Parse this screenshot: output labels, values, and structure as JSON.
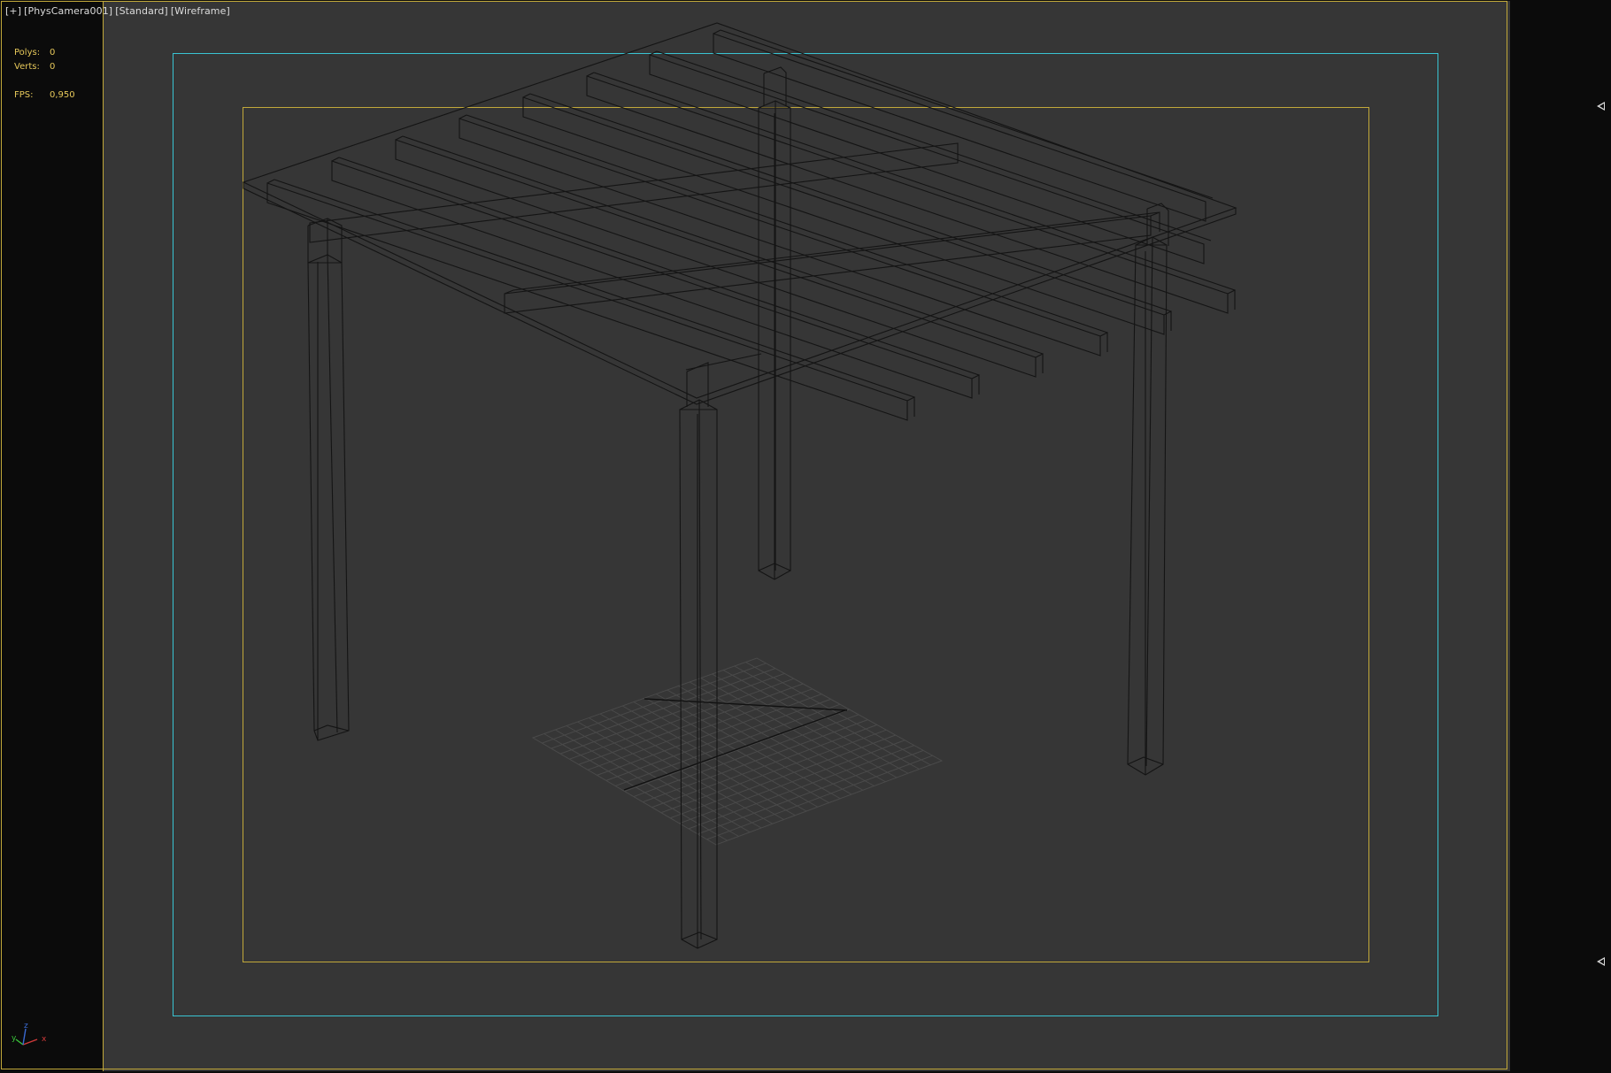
{
  "viewport": {
    "label_items": [
      "[+]",
      "[PhysCamera001]",
      "[Standard]",
      "[Wireframe]"
    ],
    "stats": {
      "polys_label": "Polys:",
      "polys_value": "0",
      "verts_label": "Verts:",
      "verts_value": "0",
      "fps_label": "FPS:",
      "fps_value": "0,950"
    },
    "colors": {
      "background": "#363636",
      "frame_border": "#c2a93a",
      "safe_frame": "#39c4d2",
      "wireframe": "#141414",
      "grid": "#8a8a8a",
      "stats_text": "#e6c85a"
    },
    "axis_gizmo": {
      "x": "x",
      "y": "y",
      "z": "z"
    },
    "side_controls": [
      "collapse-arrow-top",
      "collapse-arrow-bottom"
    ]
  }
}
